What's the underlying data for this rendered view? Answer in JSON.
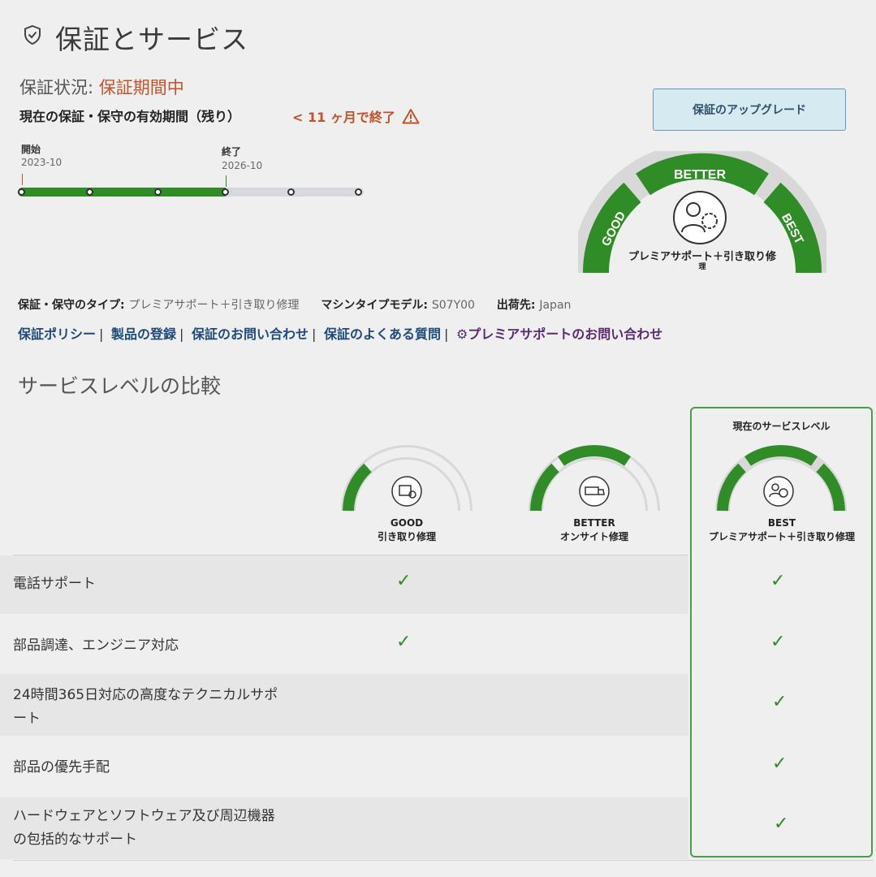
{
  "header": {
    "title": "保証とサービス",
    "icon": "shield-check-icon"
  },
  "status": {
    "label": "保証状況: ",
    "value": "保証期間中",
    "period_label": "現在の保証・保守の有効期間（残り）",
    "period_warning": "< 11 ヶ月で終了",
    "warning_icon": "warning-triangle-icon"
  },
  "upgrade_button": "保証のアップグレード",
  "timeline": {
    "start_label": "開始",
    "start_date": "2023-10",
    "end_label": "終了",
    "end_date": "2026-10",
    "progress_fraction": 0.6
  },
  "gauge_main": {
    "good": "GOOD",
    "better": "BETTER",
    "best": "BEST",
    "caption_line1": "プレミアサポート＋引き取り修",
    "caption_line2": "理",
    "icon": "premier-support-icon"
  },
  "info": {
    "type_label": "保証・保守のタイプ: ",
    "type_value": "プレミアサポート＋引き取り修理",
    "model_label": "マシンタイプモデル: ",
    "model_value": "S07Y00",
    "ship_label": "出荷先: ",
    "ship_value": "Japan"
  },
  "links": {
    "policy": "保証ポリシー",
    "register": "製品の登録",
    "contact": "保証のお問い合わせ",
    "faq": "保証のよくある質問",
    "premium": "プレミアサポートのお問い合わせ",
    "sep": "|"
  },
  "comparison": {
    "title": "サービスレベルの比較",
    "current_label": "現在のサービスレベル",
    "levels": [
      {
        "name": "GOOD",
        "desc": "引き取り修理",
        "icon": "box-repair-icon"
      },
      {
        "name": "BETTER",
        "desc": "オンサイト修理",
        "icon": "onsite-van-icon"
      },
      {
        "name": "BEST",
        "desc": "プレミアサポート＋引き取り修理",
        "icon": "premier-support-icon"
      }
    ],
    "features": [
      {
        "l1": "電話サポート",
        "l2": "",
        "good": true,
        "better": false,
        "best": true
      },
      {
        "l1": "部品調達、エンジニア対応",
        "l2": "",
        "good": true,
        "better": false,
        "best": true
      },
      {
        "l1": "24時間365日対応の高度なテクニカルサポ",
        "l2": "ート",
        "good": false,
        "better": false,
        "best": true
      },
      {
        "l1": "部品の優先手配",
        "l2": "",
        "good": false,
        "better": false,
        "best": true
      },
      {
        "l1": "ハードウェアとソフトウェア及び周辺機器",
        "l2": "の包括的なサポート",
        "good": false,
        "better": false,
        "best": true
      }
    ],
    "check_glyph": "✓"
  },
  "colors": {
    "accent_green": "#2f8c26",
    "status_red": "#c0532b",
    "link_blue": "#1e4a7a"
  }
}
